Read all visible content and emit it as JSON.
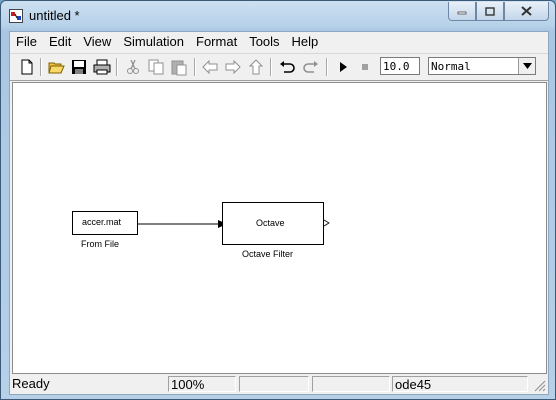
{
  "window": {
    "title": "untitled *"
  },
  "menu": [
    "File",
    "Edit",
    "View",
    "Simulation",
    "Format",
    "Tools",
    "Help"
  ],
  "toolbar": {
    "buttons": [
      "new-icon",
      "open-icon",
      "save-icon",
      "print-icon",
      "cut-icon",
      "copy-icon",
      "paste-icon",
      "back-icon",
      "forward-icon",
      "up-icon",
      "undo-icon",
      "redo-icon",
      "run-icon",
      "stop-icon"
    ],
    "stop_time": "10.0",
    "sim_mode": "Normal"
  },
  "canvas": {
    "from_file_block": {
      "text": "accer.mat",
      "label": "From File"
    },
    "octave_block": {
      "text": "Octave",
      "label": "Octave Filter"
    }
  },
  "status": {
    "state": "Ready",
    "zoom": "100%",
    "solver": "ode45"
  },
  "colors": {
    "title_bar": "#b8d2ea",
    "client_bg": "#f0f0f0",
    "close_button": "#c4d6ea"
  }
}
